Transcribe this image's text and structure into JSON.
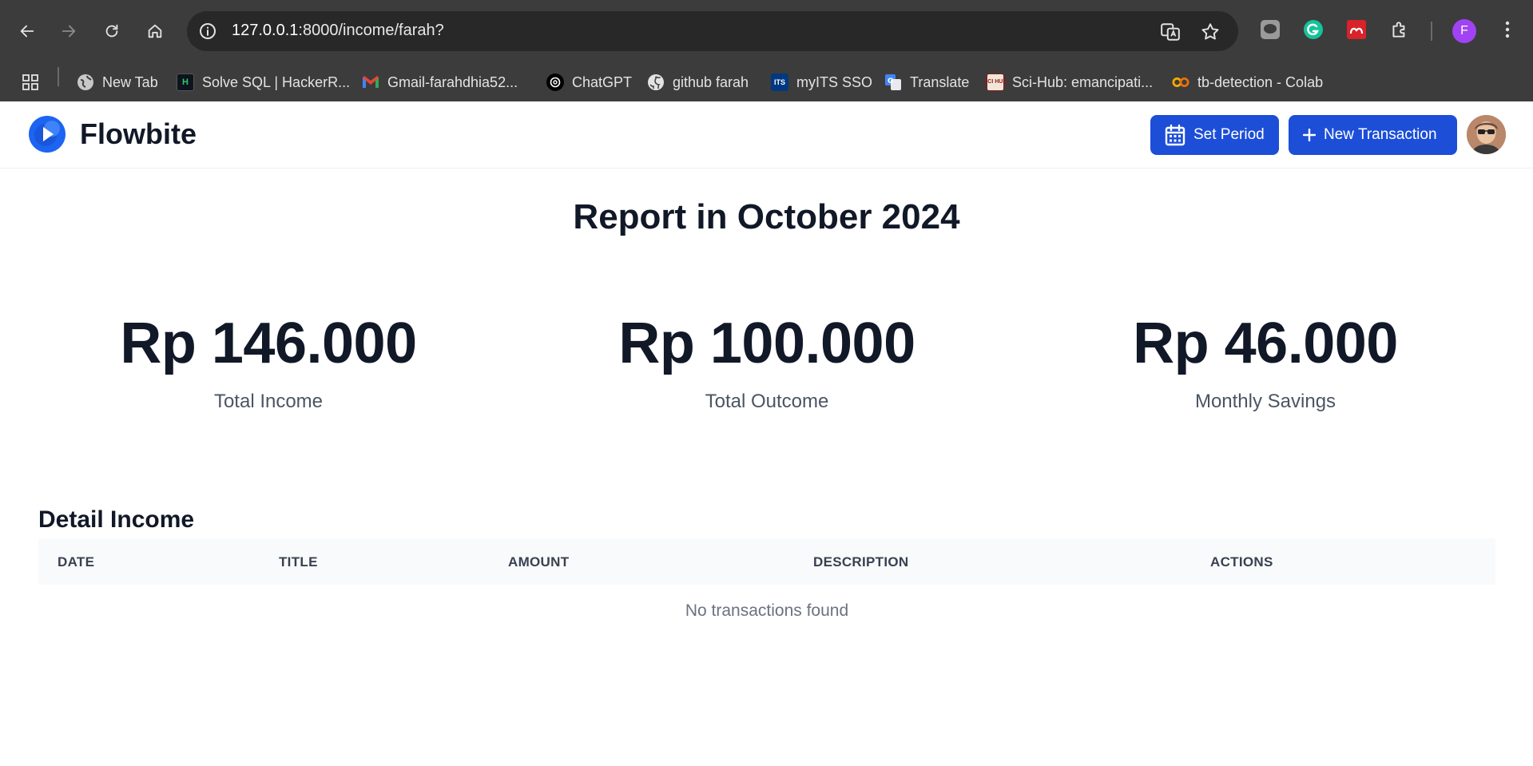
{
  "browser": {
    "url_host": "127.0.0.1",
    "url_rest": ":8000/income/farah?",
    "profile_initial": "F",
    "bookmarks": [
      {
        "label": "New Tab",
        "icon": "globe-icon"
      },
      {
        "label": "Solve SQL | HackerR...",
        "icon": "hackerrank-icon"
      },
      {
        "label": "Gmail-farahdhia52...",
        "icon": "gmail-icon"
      },
      {
        "label": "ChatGPT",
        "icon": "chatgpt-icon"
      },
      {
        "label": "github farah",
        "icon": "github-icon"
      },
      {
        "label": "myITS SSO",
        "icon": "its-icon"
      },
      {
        "label": "Translate",
        "icon": "translate-icon"
      },
      {
        "label": "Sci-Hub: emancipati...",
        "icon": "scihub-icon"
      },
      {
        "label": "tb-detection - Colab",
        "icon": "colab-icon"
      }
    ],
    "bookmark_icon_text": {
      "hackerrank": "H",
      "its": "ITS",
      "scihub": "SCI HUB"
    }
  },
  "navbar": {
    "brand": "Flowbite",
    "set_period_label": "Set Period",
    "new_transaction_label": "New Transaction"
  },
  "report": {
    "title": "Report in October 2024",
    "stats": [
      {
        "value": "Rp 146.000",
        "label": "Total Income"
      },
      {
        "value": "Rp 100.000",
        "label": "Total Outcome"
      },
      {
        "value": "Rp 46.000",
        "label": "Monthly Savings"
      }
    ]
  },
  "detail": {
    "title": "Detail Income",
    "columns": [
      "DATE",
      "TITLE",
      "AMOUNT",
      "DESCRIPTION",
      "ACTIONS"
    ],
    "empty_message": "No transactions found"
  },
  "colors": {
    "primary": "#1d4ed8",
    "chrome_bg": "#3c3c3c",
    "omnibox_bg": "#282828",
    "text_dark": "#111827"
  }
}
